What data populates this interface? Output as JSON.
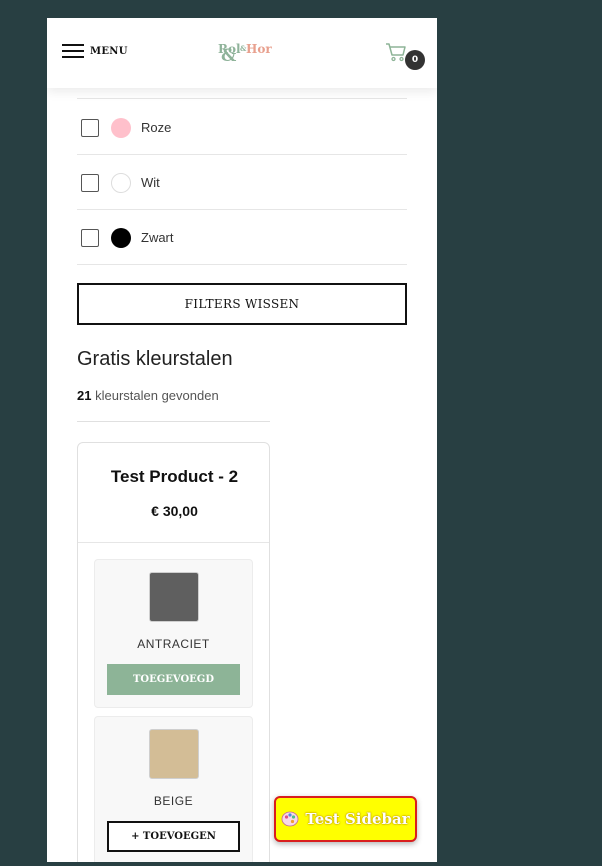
{
  "header": {
    "menu_label": "MENU",
    "logo": {
      "part1": "Rol",
      "amp_small": "&",
      "part2": "Hor",
      "amp_big": "&"
    },
    "cart_count": "0"
  },
  "colors": [
    {
      "label": "Roze",
      "swatch": "#ffc0cb"
    },
    {
      "label": "Wit",
      "swatch": "#ffffff"
    },
    {
      "label": "Zwart",
      "swatch": "#000000"
    }
  ],
  "filters_clear_label": "FILTERS WISSEN",
  "section": {
    "title": "Gratis kleurstalen",
    "count": "21",
    "count_suffix": "kleurstalen gevonden"
  },
  "product": {
    "title": "Test Product - 2",
    "price": "€ 30,00",
    "samples": [
      {
        "name": "ANTRACIET",
        "color": "#5f5f5f",
        "button": "TOEGEVOEGD",
        "added": true
      },
      {
        "name": "BEIGE",
        "color": "#d3bd96",
        "button": "+ TOEVOEGEN",
        "added": false
      }
    ]
  },
  "floating": {
    "label": "Test Sidebar",
    "icon": "palette-icon"
  },
  "theme": {
    "background": "#283f42",
    "accent_green": "#8db497",
    "logo_pink": "#e8a08e"
  }
}
